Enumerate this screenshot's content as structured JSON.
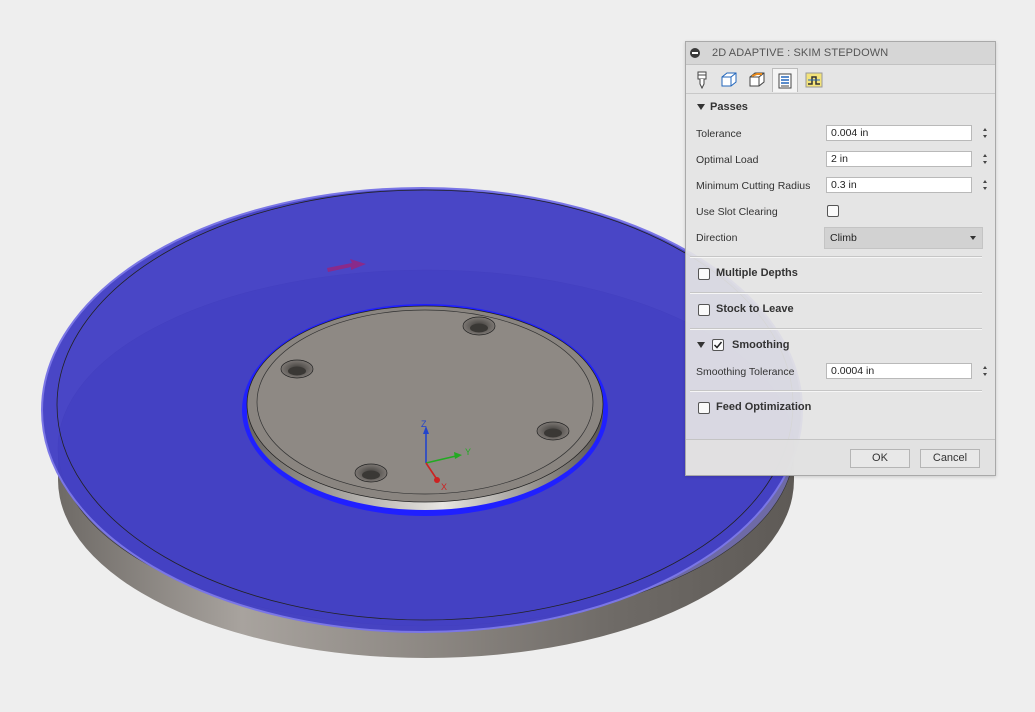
{
  "dialog": {
    "title": "2D ADAPTIVE : SKIM  STEPDOWN",
    "tabs": [
      {
        "name": "tool-tab-icon"
      },
      {
        "name": "geometry-tab-icon"
      },
      {
        "name": "heights-tab-icon"
      },
      {
        "name": "passes-tab-icon",
        "active": true
      },
      {
        "name": "linking-tab-icon"
      }
    ],
    "passes": {
      "title": "Passes",
      "tolerance_label": "Tolerance",
      "tolerance_value": "0.004 in",
      "optimal_load_label": "Optimal Load",
      "optimal_load_value": "2 in",
      "min_radius_label": "Minimum Cutting Radius",
      "min_radius_value": "0.3 in",
      "slot_label": "Use Slot Clearing",
      "slot_checked": false,
      "direction_label": "Direction",
      "direction_value": "Climb"
    },
    "multiple_depths": {
      "label": "Multiple Depths",
      "checked": false
    },
    "stock_to_leave": {
      "label": "Stock to Leave",
      "checked": false
    },
    "smoothing": {
      "label": "Smoothing",
      "checked": true,
      "tolerance_label": "Smoothing Tolerance",
      "tolerance_value": "0.0004 in"
    },
    "feed_optimization": {
      "label": "Feed Optimization",
      "checked": false
    },
    "ok_label": "OK",
    "cancel_label": "Cancel"
  },
  "triad": {
    "x": "X",
    "y": "Y",
    "z": "Z"
  },
  "colors": {
    "toolpath_blue": "#4340c4",
    "part_gray": "#8a8580",
    "background": "#eeeeee",
    "axis_x": "#cc2222",
    "axis_y": "#22aa22",
    "axis_z": "#2244cc"
  }
}
